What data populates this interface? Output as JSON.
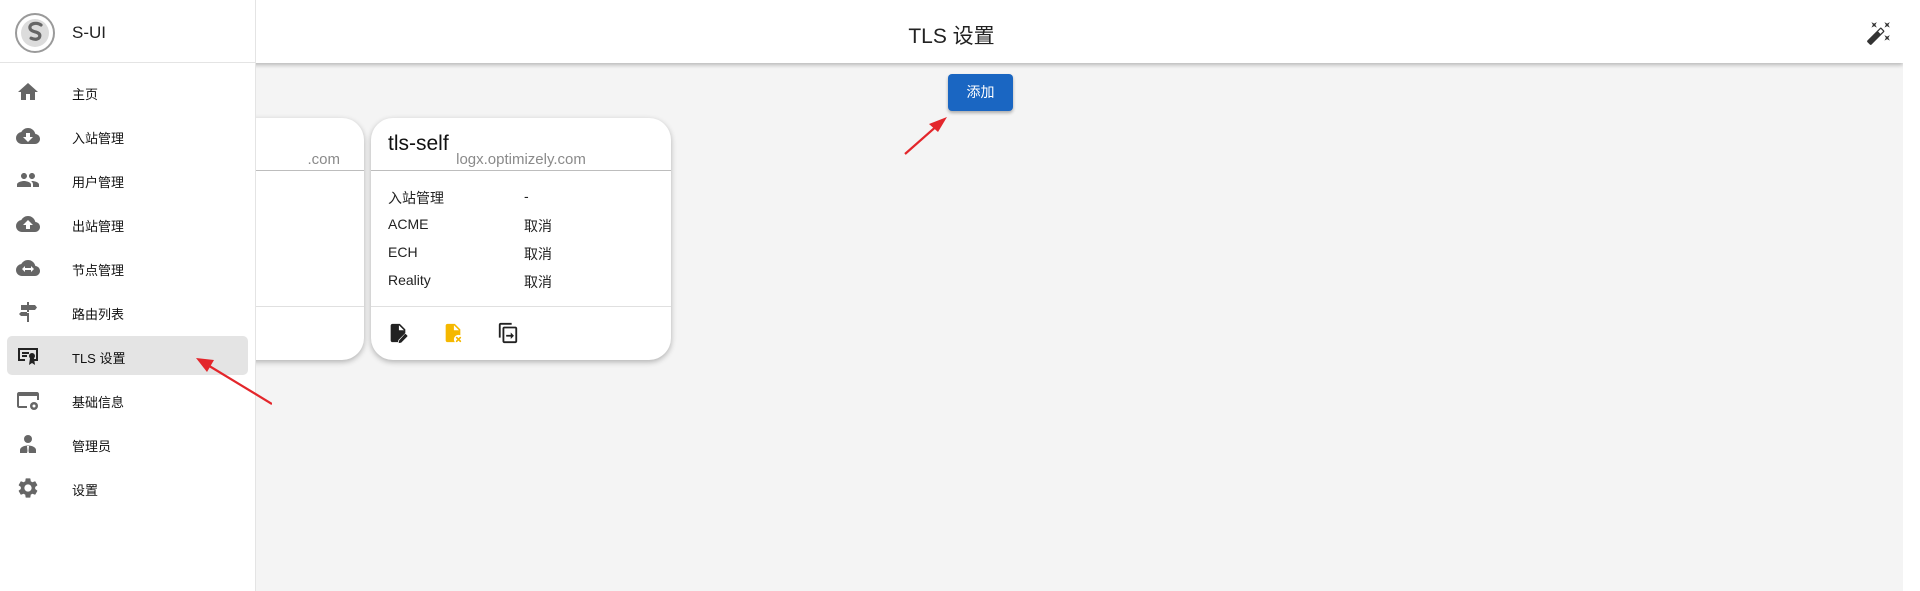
{
  "app": {
    "name": "S-UI"
  },
  "header": {
    "title": "TLS 设置"
  },
  "sidebar": {
    "items": [
      {
        "label": "主页",
        "icon": "home-icon"
      },
      {
        "label": "入站管理",
        "icon": "cloud-download-icon"
      },
      {
        "label": "用户管理",
        "icon": "users-icon"
      },
      {
        "label": "出站管理",
        "icon": "cloud-upload-icon"
      },
      {
        "label": "节点管理",
        "icon": "cloud-sync-icon"
      },
      {
        "label": "路由列表",
        "icon": "signpost-icon"
      },
      {
        "label": "TLS 设置",
        "icon": "certificate-icon",
        "active": true
      },
      {
        "label": "基础信息",
        "icon": "web-settings-icon"
      },
      {
        "label": "管理员",
        "icon": "admin-icon"
      },
      {
        "label": "设置",
        "icon": "gear-icon"
      }
    ]
  },
  "toolbar": {
    "add_label": "添加"
  },
  "cards": [
    {
      "name": "",
      "domain": ".com",
      "rows": []
    },
    {
      "name": "tls-self",
      "domain": "logx.optimizely.com",
      "rows": [
        {
          "key": "入站管理",
          "value": "-"
        },
        {
          "key": "ACME",
          "value": "取消"
        },
        {
          "key": "ECH",
          "value": "取消"
        },
        {
          "key": "Reality",
          "value": "取消"
        }
      ]
    }
  ],
  "colors": {
    "primary": "#1a66c2",
    "accent_warn": "#f5b800",
    "annotation_arrow": "#e3262b",
    "active_bg": "#e4e4e4"
  }
}
